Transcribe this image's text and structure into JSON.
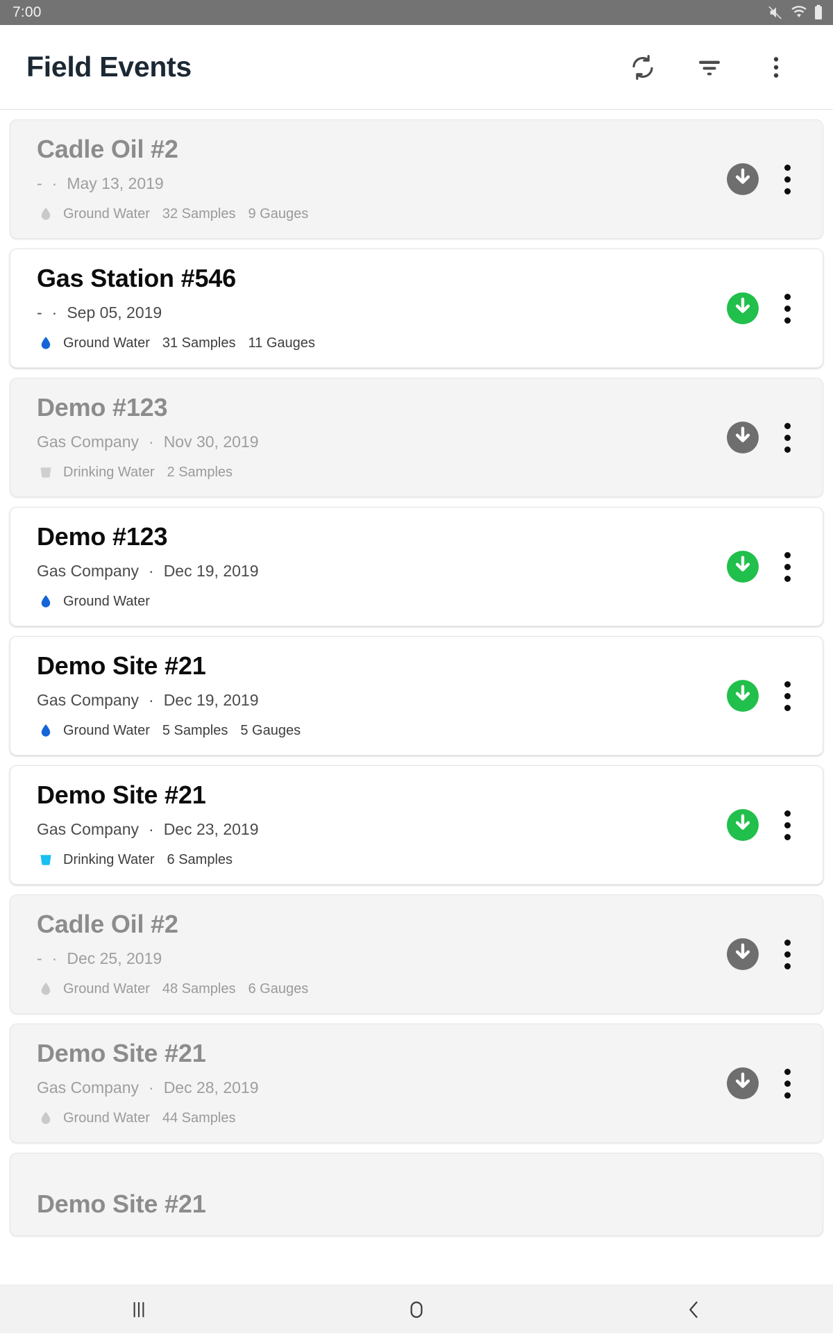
{
  "status_bar": {
    "time": "7:00",
    "icons": [
      "mute-icon",
      "wifi-icon",
      "battery-icon"
    ]
  },
  "app_bar": {
    "title": "Field Events",
    "actions": [
      {
        "name": "sync-icon",
        "label": "Sync"
      },
      {
        "name": "filter-icon",
        "label": "Filter"
      },
      {
        "name": "overflow-menu-icon",
        "label": "More options"
      }
    ]
  },
  "colors": {
    "download_active": "#21bf4b",
    "download_inactive": "#6e6e6e",
    "ground_water_active": "#1565d8",
    "ground_water_inactive": "#c9c9c9",
    "drinking_water_active": "#18c0f0",
    "drinking_water_inactive": "#cfcfcf",
    "status_bar": "#737373",
    "title": "#1c2833"
  },
  "events": [
    {
      "title": "Cadle Oil #2",
      "company": "-",
      "separator": "·",
      "date": "May 13, 2019",
      "water_type": "Ground Water",
      "water_icon": "water-drop-icon",
      "samples": "32 Samples",
      "gauges": "9 Gauges",
      "state": "downloaded",
      "download_icon": "download-circle-icon"
    },
    {
      "title": "Gas Station #546",
      "company": "-",
      "separator": "·",
      "date": "Sep 05, 2019",
      "water_type": "Ground Water",
      "water_icon": "water-drop-icon",
      "samples": "31 Samples",
      "gauges": "11 Gauges",
      "state": "available",
      "download_icon": "download-circle-icon"
    },
    {
      "title": "Demo #123",
      "company": "Gas Company",
      "separator": "·",
      "date": "Nov 30, 2019",
      "water_type": "Drinking Water",
      "water_icon": "drinking-glass-icon",
      "samples": "2 Samples",
      "gauges": "",
      "state": "downloaded",
      "download_icon": "download-circle-icon"
    },
    {
      "title": "Demo #123",
      "company": "Gas Company",
      "separator": "·",
      "date": "Dec 19, 2019",
      "water_type": "Ground Water",
      "water_icon": "water-drop-icon",
      "samples": "",
      "gauges": "",
      "state": "available",
      "download_icon": "download-circle-icon"
    },
    {
      "title": "Demo Site #21",
      "company": "Gas Company",
      "separator": "·",
      "date": "Dec 19, 2019",
      "water_type": "Ground Water",
      "water_icon": "water-drop-icon",
      "samples": "5 Samples",
      "gauges": "5 Gauges",
      "state": "available",
      "download_icon": "download-circle-icon"
    },
    {
      "title": "Demo Site #21",
      "company": "Gas Company",
      "separator": "·",
      "date": "Dec 23, 2019",
      "water_type": "Drinking Water",
      "water_icon": "drinking-glass-icon",
      "samples": "6 Samples",
      "gauges": "",
      "state": "available",
      "download_icon": "download-circle-icon"
    },
    {
      "title": "Cadle Oil #2",
      "company": "-",
      "separator": "·",
      "date": "Dec 25, 2019",
      "water_type": "Ground Water",
      "water_icon": "water-drop-icon",
      "samples": "48 Samples",
      "gauges": "6 Gauges",
      "state": "downloaded",
      "download_icon": "download-circle-icon"
    },
    {
      "title": "Demo Site #21",
      "company": "Gas Company",
      "separator": "·",
      "date": "Dec 28, 2019",
      "water_type": "Ground Water",
      "water_icon": "water-drop-icon",
      "samples": "44 Samples",
      "gauges": "",
      "state": "downloaded",
      "download_icon": "download-circle-icon"
    },
    {
      "title": "Demo Site #21",
      "company": "",
      "separator": "",
      "date": "",
      "water_type": "",
      "water_icon": "",
      "samples": "",
      "gauges": "",
      "state": "downloaded",
      "download_icon": "download-circle-icon"
    }
  ],
  "nav_bar": {
    "buttons": [
      {
        "name": "recents-icon",
        "label": "Recents"
      },
      {
        "name": "home-icon",
        "label": "Home"
      },
      {
        "name": "back-icon",
        "label": "Back"
      }
    ]
  }
}
